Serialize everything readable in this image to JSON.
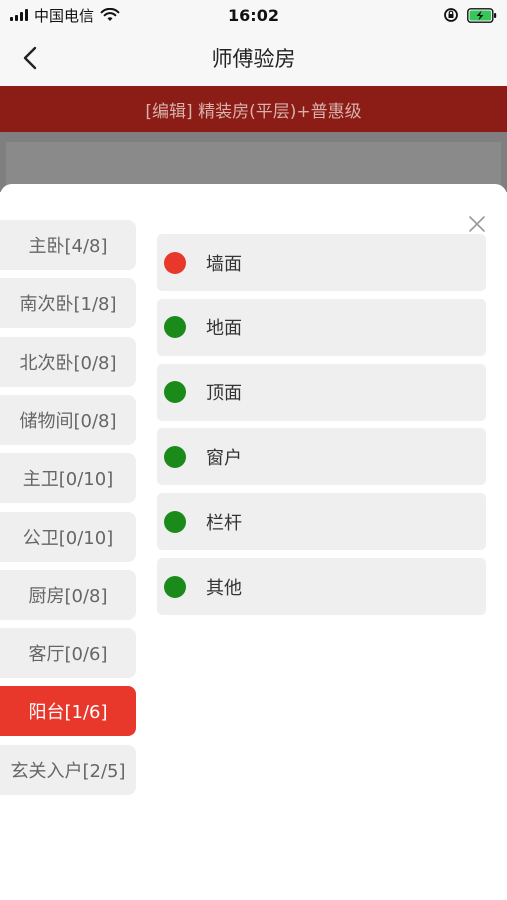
{
  "status_bar": {
    "carrier": "中国电信",
    "time": "16:02"
  },
  "nav": {
    "title": "师傅验房"
  },
  "banner": {
    "text": "[编辑] 精装房(平层)+普惠级"
  },
  "rooms": [
    {
      "label": "主卧[4/8]",
      "active": false
    },
    {
      "label": "南次卧[1/8]",
      "active": false
    },
    {
      "label": "北次卧[0/8]",
      "active": false
    },
    {
      "label": "储物间[0/8]",
      "active": false
    },
    {
      "label": "主卫[0/10]",
      "active": false
    },
    {
      "label": "公卫[0/10]",
      "active": false
    },
    {
      "label": "厨房[0/8]",
      "active": false
    },
    {
      "label": "客厅[0/6]",
      "active": false
    },
    {
      "label": "阳台[1/6]",
      "active": true
    },
    {
      "label": "玄关入户[2/5]",
      "active": false
    }
  ],
  "categories": [
    {
      "label": "墙面",
      "status_color": "#e8382c"
    },
    {
      "label": "地面",
      "status_color": "#1a8a1a"
    },
    {
      "label": "顶面",
      "status_color": "#1a8a1a"
    },
    {
      "label": "窗户",
      "status_color": "#1a8a1a"
    },
    {
      "label": "栏杆",
      "status_color": "#1a8a1a"
    },
    {
      "label": "其他",
      "status_color": "#1a8a1a"
    }
  ],
  "colors": {
    "accent": "#e8382c",
    "banner": "#8b1c16",
    "ok": "#1a8a1a"
  }
}
